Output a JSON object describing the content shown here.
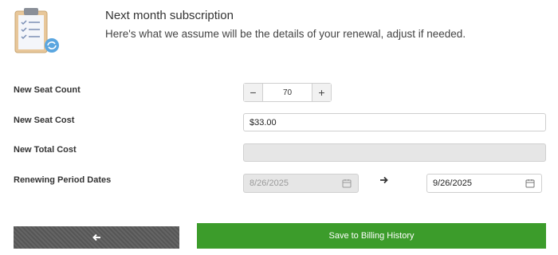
{
  "header": {
    "icon": "clipboard-checklist-icon",
    "title": "Next month subscription",
    "subtitle": "Here's what we assume will be the details of your renewal, adjust if needed."
  },
  "form": {
    "seat_count": {
      "label": "New Seat Count",
      "value": "70",
      "minus": "−",
      "plus": "+"
    },
    "seat_cost": {
      "label": "New Seat Cost",
      "value": "$33.00"
    },
    "total_cost": {
      "label": "New Total Cost",
      "value": ""
    },
    "period": {
      "label": "Renewing Period Dates",
      "start": "8/26/2025",
      "end": "9/26/2025",
      "separator_icon": "arrow-right-icon"
    }
  },
  "actions": {
    "back_icon": "arrow-left-icon",
    "save_label": "Save to Billing History"
  },
  "colors": {
    "save_button": "#3c9c2b",
    "back_button": "#5b5b5b",
    "disabled_field": "#e6e6e6"
  }
}
